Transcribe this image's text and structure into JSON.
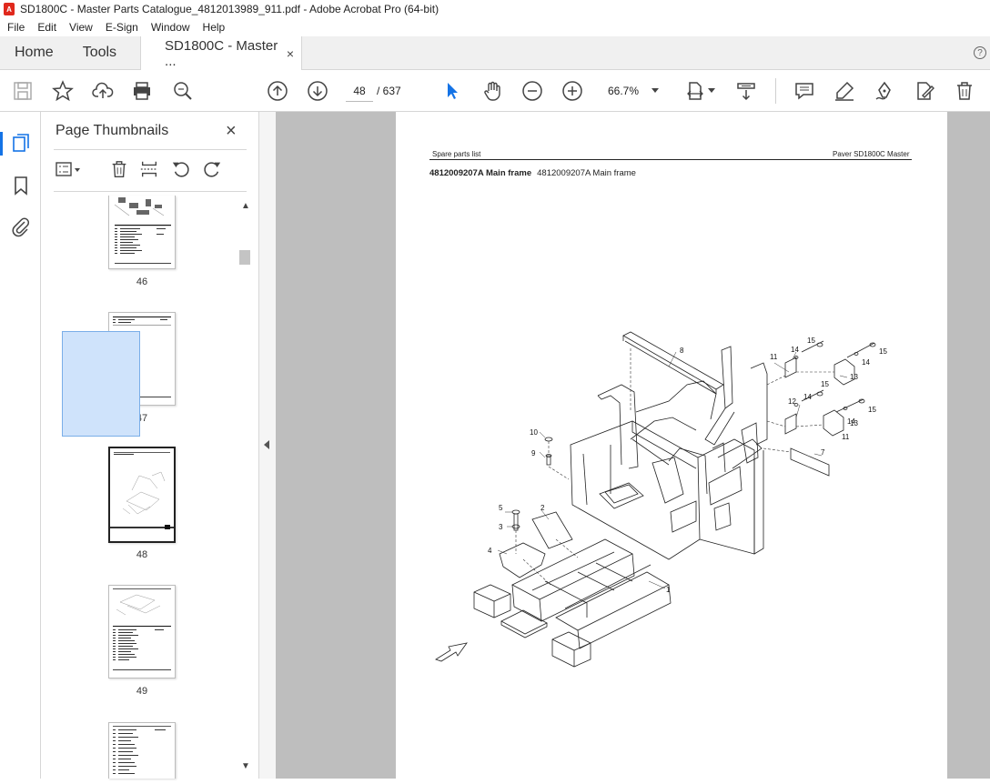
{
  "window": {
    "title": "SD1800C - Master Parts Catalogue_4812013989_911.pdf - Adobe Acrobat Pro (64-bit)"
  },
  "menu": [
    "File",
    "Edit",
    "View",
    "E-Sign",
    "Window",
    "Help"
  ],
  "tabs": {
    "home": "Home",
    "tools": "Tools",
    "document": "SD1800C - Master ...",
    "close_symbol": "×"
  },
  "toolbar": {
    "current_page": "48",
    "total_pages": "/ 637",
    "zoom": "66.7%"
  },
  "thumbnails_panel": {
    "title": "Page Thumbnails",
    "close_symbol": "×",
    "pages": [
      "46",
      "47",
      "48",
      "49"
    ],
    "selected_page": "48"
  },
  "document": {
    "header_left": "Spare parts list",
    "header_right": "Paver SD1800C Master",
    "section_code": "4812009207A Main frame",
    "section_name": "4812009207A Main frame",
    "callouts": [
      "1",
      "2",
      "3",
      "4",
      "5",
      "7",
      "8",
      "9",
      "10",
      "11",
      "12",
      "13",
      "14",
      "15"
    ]
  },
  "colors": {
    "accent": "#1473e6",
    "acrobat_red": "#e0281c",
    "doc_background": "#bebebe"
  }
}
